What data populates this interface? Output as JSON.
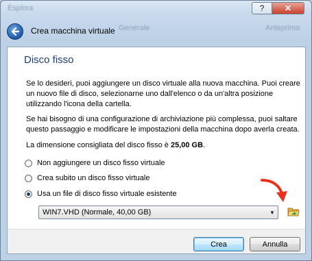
{
  "window": {
    "help_glyph": "?",
    "close_glyph": "✕",
    "title": "Crea macchina virtuale",
    "background_hints": [
      "Esplora",
      "Generale",
      "Anteprima"
    ]
  },
  "page": {
    "heading": "Disco fisso",
    "paragraph1": "Se lo desideri, puoi aggiungere un disco virtuale alla nuova macchina. Puoi creare un nuovo file di disco, selezionarne uno dall'elenco o da un'altra posizione utilizzando l'icona della cartella.",
    "paragraph2": "Se hai bisogno di una configurazione di archiviazione più complessa, puoi saltare questo passaggio e modificare le impostazioni della macchina dopo averla creata.",
    "recommended_prefix": "La dimensione consigliata del disco fisso è ",
    "recommended_size": "25,00 GB",
    "recommended_suffix": "."
  },
  "options": [
    {
      "label": "Non aggiungere un disco fisso virtuale",
      "selected": false
    },
    {
      "label": "Crea subito un disco fisso virtuale",
      "selected": false
    },
    {
      "label": "Usa un file di disco fisso virtuale esistente",
      "selected": true
    }
  ],
  "disk_select": {
    "value": "WIN7.VHD (Normale, 40,00 GB)"
  },
  "icons": {
    "folder": "folder-open-icon",
    "back": "back-arrow-icon",
    "annotation": "red-arrow-annotation"
  },
  "buttons": {
    "create": "Crea",
    "cancel": "Annulla"
  },
  "colors": {
    "heading": "#1e3d73",
    "annotation": "#e8321e",
    "default_button": "#3c7fb1"
  }
}
